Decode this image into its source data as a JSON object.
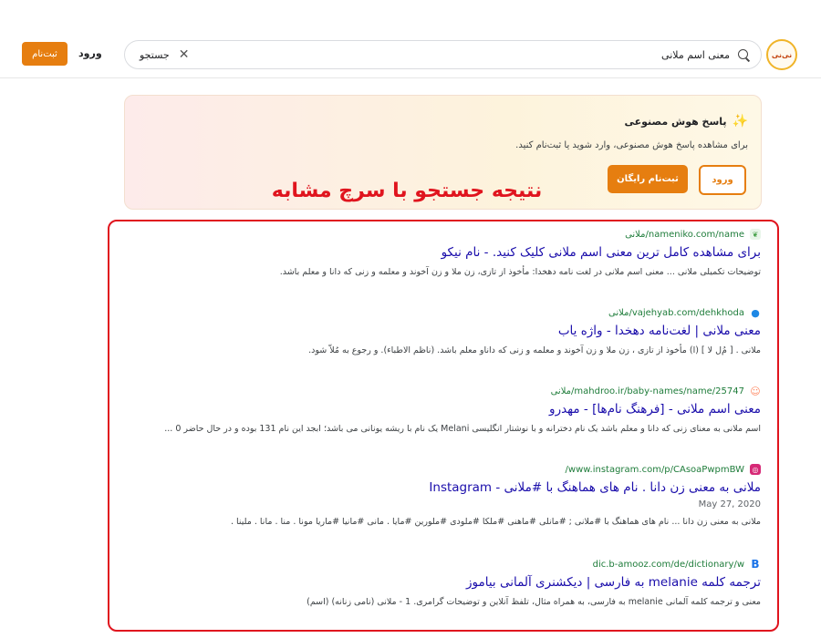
{
  "header": {
    "logo_text": "نی‌نی",
    "search_query": "معنی اسم ملانی",
    "search_button": "جستجو",
    "login": "ورود",
    "signup": "ثبت‌نام"
  },
  "ai": {
    "title": "پاسخ هوش مصنوعی",
    "description": "برای مشاهده پاسخ هوش مصنوعی، وارد شوید یا ثبت‌نام کنید.",
    "login": "ورود",
    "signup": "ثبت‌نام رایگان"
  },
  "annotation": "نتیجه جستجو با سرچ مشابه",
  "results": [
    {
      "url": "nameniko.com/name/ملانی",
      "title": "برای مشاهده کامل ترین معنی اسم ملانی کلیک کنید. - نام نیکو",
      "snippet": "توضیحات تکمیلی ملانی ... معنی اسم ملانی در لغت نامه دهخدا: مأخوذ از تازی، زن ملا و زن آخوند و معلمه و زنی که دانا و معلم باشد.",
      "favicon_color": "#8bc34a",
      "favicon_icon": "leaf-icon"
    },
    {
      "url": "vajehyab.com/dehkhoda/ملانی",
      "title": "معنی ملانی | لغت‌نامه دهخدا - واژه یاب",
      "snippet": "ملانی . [ مُ‌ل‌ لا ] (ا) مأخوذ از تازی ، زن ملا و زن آخوند و معلمه و زنی که داناو معلم باشد. (ناظم الاطباء). و رجوع به مُلاّ شود.",
      "favicon_color": "#1e88e5",
      "favicon_icon": "pin-icon"
    },
    {
      "url": "mahdroo.ir/baby-names/name/25747/ملانی",
      "title": "معنی اسم ملانی - [فرهنگ نام‌ها] - مهدرو",
      "snippet": "اسم ملانی به معنای زنی که دانا و معلم باشد یک نام دخترانه و با نوشتار انگلیسی Melani یک نام با ریشه یونانی می باشد؛ ابجد این نام 131 بوده و در حال حاضر 0 ...",
      "favicon_color": "#ff8a65",
      "favicon_icon": "baby-icon"
    },
    {
      "url": "www.instagram.com/p/CAsoaPwpmBW/",
      "title": "ملانی به معنی زن دانا . نام های هماهنگ با #ملانی - Instagram",
      "date": "May 27, 2020",
      "snippet": "ملانی به معنی زن دانا ... نام های هماهنگ با #ملانی ; #مانلی #ماهنی #ملکا #ملودی #ملورین #مایا . مانی #مانیا #ماریا مونا . منا . مانا . ملینا .",
      "favicon_color": "#d62976",
      "favicon_icon": "instagram-icon"
    },
    {
      "url": "dic.b-amooz.com/de/dictionary/w",
      "title": "ترجمه کلمه melanie به فارسی | دیکشنری آلمانی بیاموز",
      "snippet": "معنی و ترجمه کلمه آلمانی melanie به فارسی، به همراه مثال، تلفظ آنلاین و توضیحات گرامری. 1 - ملانی (نامی زنانه) (اسم)",
      "favicon_color": "#1a73e8",
      "favicon_icon": "b-logo-icon"
    }
  ]
}
